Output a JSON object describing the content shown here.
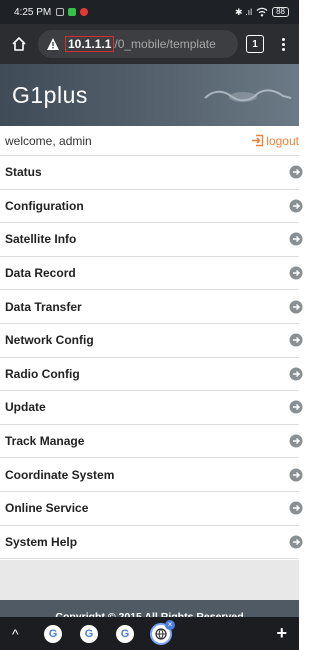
{
  "status_bar": {
    "time": "4:25 PM",
    "right_text": "✱ .ıl",
    "battery": "88"
  },
  "browser": {
    "url_host": "10.1.1.1",
    "url_path": "/0_mobile/template",
    "tab_count": "1"
  },
  "app": {
    "title": "G1plus"
  },
  "user": {
    "welcome": "welcome, admin",
    "logout": "logout"
  },
  "menu": {
    "items": [
      "Status",
      "Configuration",
      "Satellite Info",
      "Data Record",
      "Data Transfer",
      "Network Config",
      "Radio Config",
      "Update",
      "Track Manage",
      "Coordinate System",
      "Online Service",
      "System Help"
    ]
  },
  "footer": {
    "copyright": "Copyright © 2015 All Rights Reserved"
  },
  "bottom_bar": {
    "tabs": [
      "G",
      "G",
      "G"
    ]
  },
  "colors": {
    "header_bg": "#56636e",
    "logout_accent": "#e8833a",
    "footer_bg": "#505a64",
    "url_highlight": "#d32f2f"
  },
  "icons": {
    "home": "home-icon",
    "warning": "warning-icon",
    "logout": "logout-icon",
    "arrow": "circle-arrow-right-icon"
  }
}
